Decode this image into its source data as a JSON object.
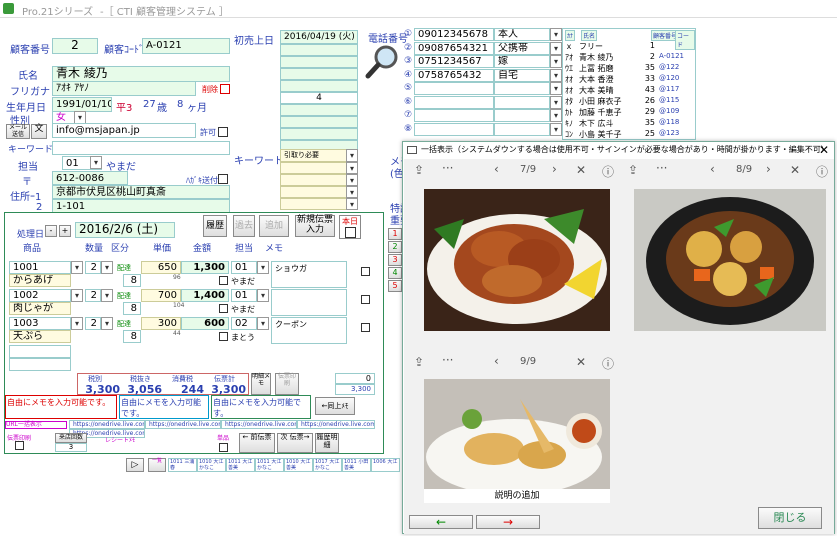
{
  "titlebar": {
    "app": "Pro.21シリーズ",
    "subtitle": "-［ CTI 顧客管理システム ］"
  },
  "customer": {
    "no_label": "顧客番号",
    "no": "2",
    "code_label": "顧客ｺｰﾄﾞ",
    "code": "A-0121",
    "first_sale_label": "初売上日",
    "first_sale_date": "2016/04/19 (火)",
    "name_label": "氏名",
    "name": "青木 綾乃",
    "kana_label": "フリガナ",
    "kana": "ｱｵｷ ｱﾔﾉ",
    "delete_label": "削除",
    "dob_label": "生年月日",
    "dob": "1991/01/10",
    "era": "平3",
    "age": "27",
    "age_unit": "歳",
    "months": "8",
    "months_unit": "ヶ月",
    "gender_label": "性別",
    "gender": "女",
    "mail_label": "メール送信",
    "mail_btn": "文",
    "email": "info@msjapan.jp",
    "permit_label": "許可",
    "keyword_label": "キーワード",
    "staff_label": "担当",
    "staff_code": "01",
    "staff_name": "やまだ",
    "zip_label": "〒",
    "zip": "612-0086",
    "dm_label": "ﾊｶﾞｷ送付",
    "addr1_label": "住所ｰ1",
    "addr1": "京都市伏見区桃山町真斎",
    "addr2_label": "2",
    "addr2": "1-101",
    "side_value": "4",
    "keyword2_label": "キーワード",
    "keyword2_value": "引取り必要"
  },
  "phones": {
    "label": "電話番号",
    "rows": [
      {
        "n": "①",
        "num": "09012345678",
        "type": "本人"
      },
      {
        "n": "②",
        "num": "09087654321",
        "type": "父携帯"
      },
      {
        "n": "③",
        "num": "0751234567",
        "type": "嫁"
      },
      {
        "n": "④",
        "num": "0758765432",
        "type": "自宅"
      },
      {
        "n": "⑤",
        "num": "",
        "type": ""
      },
      {
        "n": "⑥",
        "num": "",
        "type": ""
      },
      {
        "n": "⑦",
        "num": "",
        "type": ""
      },
      {
        "n": "⑧",
        "num": "",
        "type": ""
      }
    ]
  },
  "kana_list": {
    "headers": [
      "ｶﾅ",
      "氏名",
      "顧客番号",
      "コード"
    ],
    "rows": [
      {
        "k": "ｘ",
        "name": "フリー",
        "no": "1",
        "code": ""
      },
      {
        "k": "ｱｵ",
        "name": "青木 綾乃",
        "no": "2",
        "code": "A-0121"
      },
      {
        "k": "ｳｴ",
        "name": "上冨 拓磨",
        "no": "35",
        "code": "@122"
      },
      {
        "k": "ｵｵ",
        "name": "大本 香澄",
        "no": "33",
        "code": "@120"
      },
      {
        "k": "ｵｵ",
        "name": "大本 美晴",
        "no": "43",
        "code": "@117"
      },
      {
        "k": "ｵﾀ",
        "name": "小田 麻衣子",
        "no": "26",
        "code": "@115"
      },
      {
        "k": "ｶﾄ",
        "name": "加藤 千恵子",
        "no": "29",
        "code": "@109"
      },
      {
        "k": "ｷﾉ",
        "name": "木下 広斗",
        "no": "35",
        "code": "@118"
      },
      {
        "k": "ｺﾝ",
        "name": "小島 美千子",
        "no": "25",
        "code": "@123"
      }
    ]
  },
  "side_labels": {
    "memo": "メモ",
    "color": "(色",
    "special": "特記",
    "important": "重要"
  },
  "side_numbers": [
    "1",
    "2",
    "3",
    "4",
    "5"
  ],
  "sales": {
    "date_label": "処理日",
    "date": "2016/2/6 (土)",
    "history_btn": "履歴",
    "history_sub": "過去",
    "prev_btn": "追加",
    "new_slip_btn": "新規伝票入力",
    "done_label": "本日",
    "headers": [
      "商品",
      "数量",
      "区分",
      "単価",
      "金額",
      "担当",
      "メモ"
    ],
    "rows": [
      {
        "code": "1001",
        "qty": "2",
        "kind": "配達",
        "price": "650",
        "amount": "1,300",
        "staff": "01",
        "staff_name": "やまだ",
        "memo": "ショウガ",
        "name": "からあげ",
        "lot": "8",
        "sub": "96"
      },
      {
        "code": "1002",
        "qty": "2",
        "kind": "配達",
        "price": "700",
        "amount": "1,400",
        "staff": "01",
        "staff_name": "やまだ",
        "memo": "",
        "name": "肉じゃが",
        "lot": "8",
        "sub": "104"
      },
      {
        "code": "1003",
        "qty": "2",
        "kind": "配達",
        "price": "300",
        "amount": "600",
        "staff": "02",
        "staff_name": "まとう",
        "memo": "クーポン",
        "name": "天ぷら",
        "lot": "8",
        "sub": "44"
      }
    ],
    "totals_labels": [
      "税別",
      "税抜き",
      "消費税",
      "伝票計"
    ],
    "totals": [
      "3,300",
      "3,056",
      "244",
      "3,300"
    ],
    "memo_btn": "明細メモ",
    "clear_btn": "伝票印刷",
    "count": "0",
    "count2": "3,300",
    "free_memo1": "自由にメモを入力可能です。",
    "free_memo2": "自由にメモを入力可能です。",
    "free_memo3": "自由にメモを入力可能です。",
    "detail_btn": "←同上ﾒﾓ",
    "url_label": "URL一括表示",
    "url1": "https://onedrive.live.com/?cid=8F",
    "url2": "https://onedrive.live.com/?cid=8F",
    "url3": "https://onedrive.live.com/?cid=8F",
    "url4": "https://onedrive.live.com/?cid=8F",
    "url5": "https://onedrive.live.com/?cid=8F",
    "slip_label": "伝票印刷",
    "cust_rank_label": "来店回数",
    "cust_rank": "3",
    "receipt_label": "レシートﾒﾓ",
    "prev_slip": "← 前伝票",
    "next_slip": "次 伝票→",
    "history_detail": "履歴明細",
    "single_label": "単品"
  },
  "bottom_strip": {
    "cells": [
      "1011 三浦 春",
      "1010 大江 かなこ",
      "1011 大江 善美",
      "1011 大江 かなこ",
      "1010 大江 善美",
      "1017 大江 かなこ",
      "1011 小田 善美",
      "1006 大江"
    ]
  },
  "dialog": {
    "title": "一括表示（システムダウンする場合は使用不可・サインインが必要な場合があり・時間が掛かります・編集不可）",
    "panels": [
      {
        "counter": "7/9"
      },
      {
        "counter": "8/9"
      },
      {
        "counter": "9/9",
        "caption": "説明の追加"
      }
    ],
    "prev_btn": "←",
    "next_btn": "→",
    "close_btn": "閉じる"
  },
  "colors": {
    "label": "#2a3fb0",
    "accent_green": "#2e8b57",
    "field_border": "#99cccc"
  }
}
